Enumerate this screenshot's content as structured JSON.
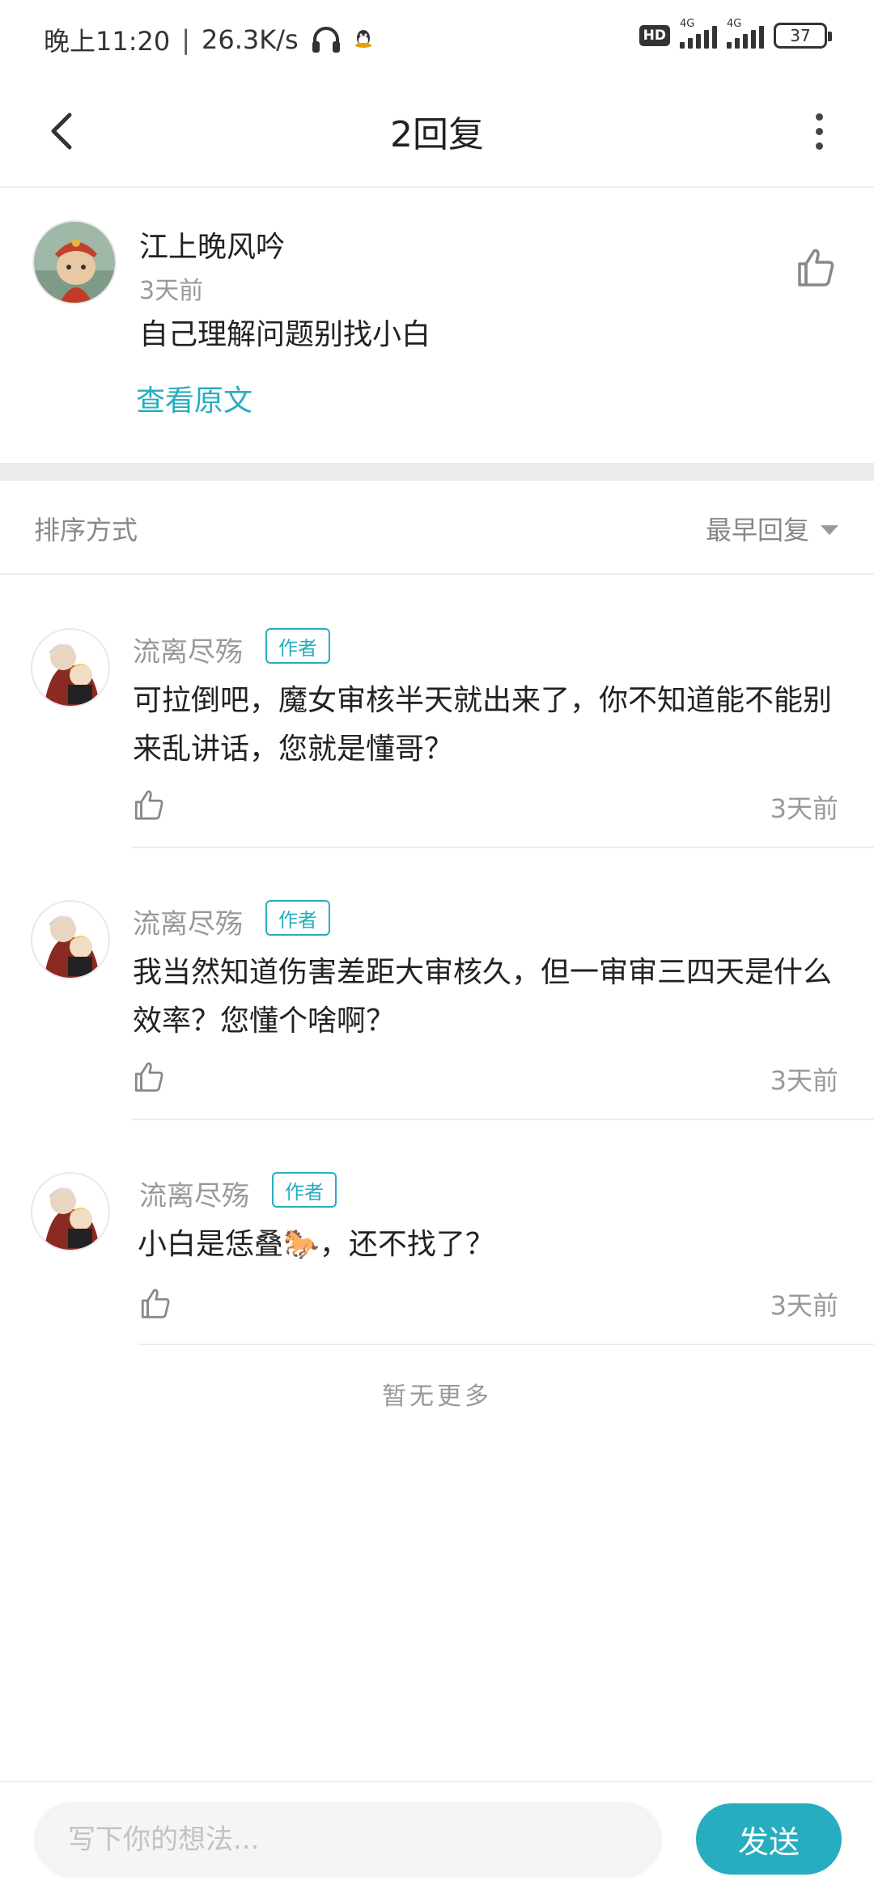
{
  "status_bar": {
    "time_speed": "晚上11:20",
    "separator": "|",
    "speed": "26.3K/s",
    "hd": "HD",
    "network_1": "4G",
    "network_2": "4G",
    "battery": "37",
    "icons": [
      "headphone-icon",
      "qq-icon"
    ]
  },
  "header": {
    "title": "2回复",
    "back_icon": "back-arrow-icon",
    "more_icon": "more-dots-icon"
  },
  "main_post": {
    "username": "江上晚风吟",
    "time": "3天前",
    "content": "自己理解问题别找小白",
    "view_original": "查看原文",
    "like_icon": "thumbs-up-icon"
  },
  "sort": {
    "label": "排序方式",
    "selected": "最早回复"
  },
  "replies": [
    {
      "username": "流离尽殇",
      "badge": "作者",
      "text": "可拉倒吧，魔女审核半天就出来了，你不知道能不能别来乱讲话，您就是懂哥？",
      "time": "3天前"
    },
    {
      "username": "流离尽殇",
      "badge": "作者",
      "text": "我当然知道伤害差距大审核久，但一审审三四天是什么效率？您懂个啥啊？",
      "time": "3天前"
    },
    {
      "username": "流离尽殇",
      "badge": "作者",
      "text": "小白是恁叠🐎，还不找了？",
      "time": "3天前"
    }
  ],
  "footer_note": "暂无更多",
  "composer": {
    "placeholder": "写下你的想法...",
    "send_label": "发送"
  },
  "colors": {
    "accent": "#27adbf",
    "muted_text": "#999999",
    "divider": "#ebebeb"
  }
}
